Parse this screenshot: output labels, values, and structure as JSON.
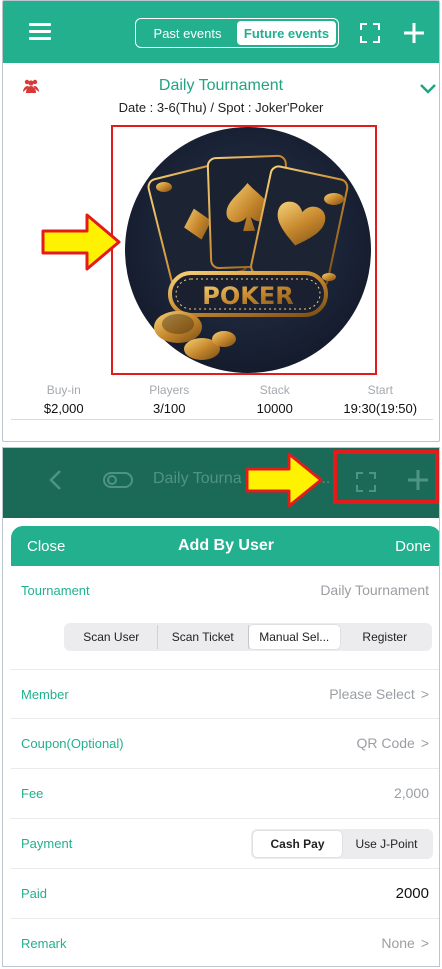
{
  "top": {
    "segments": [
      "Past events",
      "Future events"
    ],
    "active_segment": "Future events",
    "icons": {
      "menu": "menu-icon",
      "expand": "expand-icon",
      "add": "plus-icon"
    }
  },
  "event": {
    "title": "Daily Tournament",
    "subtitle": "Date : 3-6(Thu) / Spot : Joker'Poker",
    "image_text": "POKER",
    "stats": [
      {
        "label": "Buy-in",
        "value": "$2,000"
      },
      {
        "label": "Players",
        "value": "3/100"
      },
      {
        "label": "Stack",
        "value": "10000"
      },
      {
        "label": "Start",
        "value": "19:30(19:50)"
      }
    ]
  },
  "bottom_header": {
    "title": "Daily Tourna",
    "ellipsis": "..."
  },
  "sheet": {
    "close": "Close",
    "title": "Add By User",
    "done": "Done"
  },
  "form": {
    "tournament_label": "Tournament",
    "tournament_value": "Daily Tournament",
    "tabs": [
      "Scan User",
      "Scan Ticket",
      "Manual Sel...",
      "Register"
    ],
    "active_tab": "Manual Sel...",
    "member_label": "Member",
    "member_value": "Please Select",
    "coupon_label": "Coupon(Optional)",
    "coupon_value": "QR Code",
    "fee_label": "Fee",
    "fee_value": "2,000",
    "payment_label": "Payment",
    "payment_options": [
      "Cash Pay",
      "Use J-Point"
    ],
    "active_payment": "Cash Pay",
    "paid_label": "Paid",
    "paid_value": "2000",
    "remark_label": "Remark",
    "remark_value": "None",
    "caret": ">"
  },
  "colors": {
    "accent": "#22b08f",
    "dim_header": "#1b6a57",
    "annotation_red": "#e21b1b",
    "annotation_yellow": "#fff200"
  }
}
